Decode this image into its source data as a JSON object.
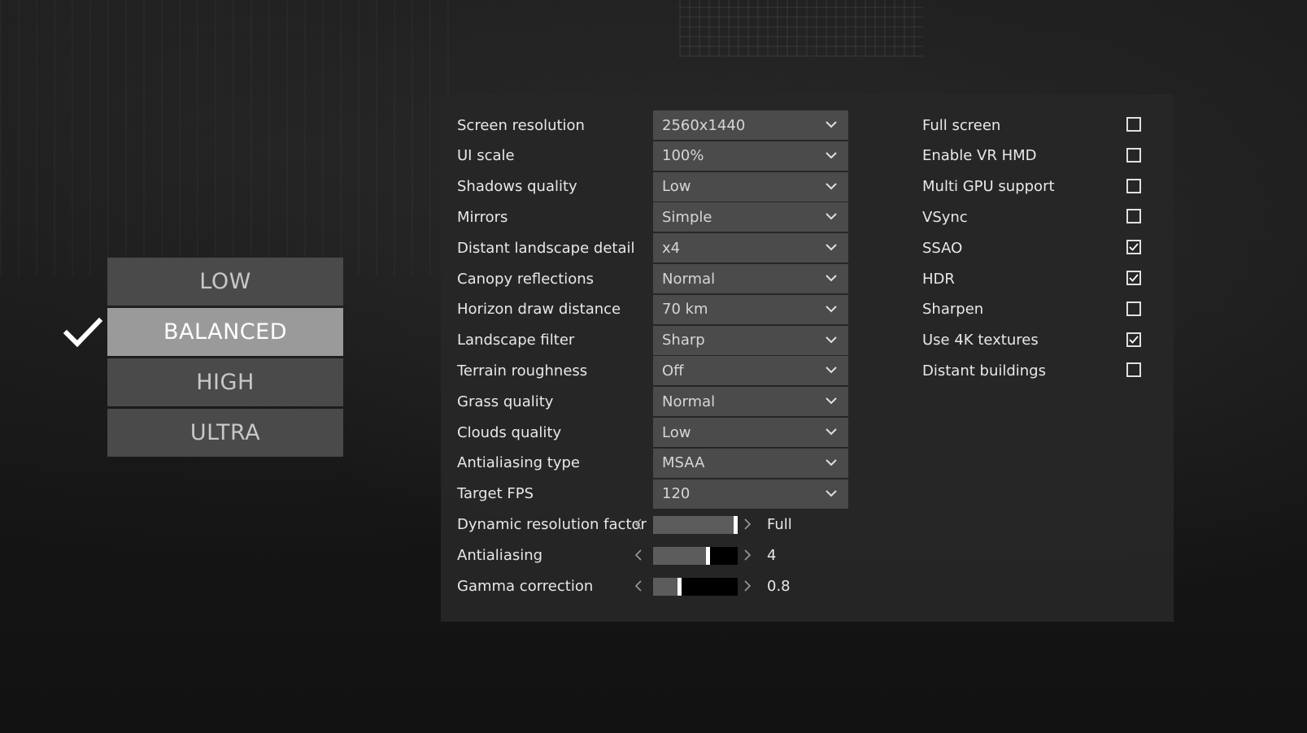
{
  "presets": {
    "items": [
      {
        "label": "LOW",
        "active": false
      },
      {
        "label": "BALANCED",
        "active": true
      },
      {
        "label": "HIGH",
        "active": false
      },
      {
        "label": "ULTRA",
        "active": false
      }
    ],
    "selected_icon": "checkmark-icon"
  },
  "dropdowns": [
    {
      "label": "Screen resolution",
      "value": "2560x1440"
    },
    {
      "label": "UI scale",
      "value": "100%"
    },
    {
      "label": "Shadows quality",
      "value": "Low"
    },
    {
      "label": "Mirrors",
      "value": "Simple"
    },
    {
      "label": "Distant landscape detail",
      "value": "x4"
    },
    {
      "label": "Canopy reflections",
      "value": "Normal"
    },
    {
      "label": "Horizon draw distance",
      "value": "70 km"
    },
    {
      "label": "Landscape filter",
      "value": "Sharp"
    },
    {
      "label": "Terrain roughness",
      "value": "Off"
    },
    {
      "label": "Grass quality",
      "value": "Normal"
    },
    {
      "label": "Clouds quality",
      "value": "Low"
    },
    {
      "label": "Antialiasing type",
      "value": "MSAA"
    },
    {
      "label": "Target FPS",
      "value": "120"
    }
  ],
  "sliders": [
    {
      "label": "Dynamic resolution factor",
      "value": "Full",
      "level": 1.0
    },
    {
      "label": "Antialiasing",
      "value": "4",
      "level": 0.66
    },
    {
      "label": "Gamma correction",
      "value": "0.8",
      "level": 0.3
    }
  ],
  "checkboxes": [
    {
      "label": "Full screen",
      "checked": false
    },
    {
      "label": "Enable VR HMD",
      "checked": false
    },
    {
      "label": "Multi GPU support",
      "checked": false
    },
    {
      "label": "VSync",
      "checked": false
    },
    {
      "label": "SSAO",
      "checked": true
    },
    {
      "label": "HDR",
      "checked": true
    },
    {
      "label": "Sharpen",
      "checked": false
    },
    {
      "label": "Use 4K textures",
      "checked": true
    },
    {
      "label": "Distant buildings",
      "checked": false
    }
  ],
  "colors": {
    "panel_bg": "#262626",
    "control_bg": "#4b4b4b",
    "preset_active": "#9a9a9a",
    "preset_inactive": "#4a4a4a",
    "text": "#e8e8e8"
  }
}
